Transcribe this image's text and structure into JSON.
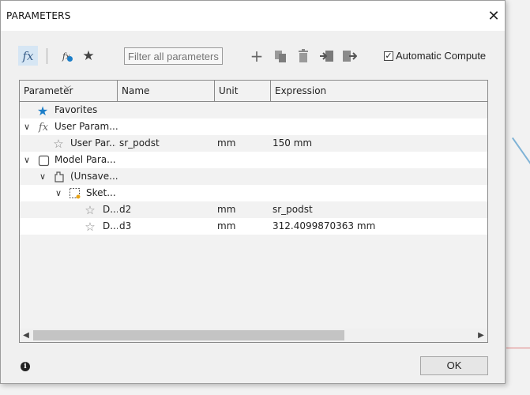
{
  "dialog": {
    "title": "PARAMETERS"
  },
  "toolbar": {
    "fx_label": "fx",
    "fx_user_label": "fx",
    "filter_placeholder": "Filter all parameters",
    "auto_compute_label": "Automatic Compute",
    "auto_compute_checked": "✓",
    "plus": "+"
  },
  "table": {
    "columns": [
      "Parameter",
      "Name",
      "Unit",
      "Expression"
    ],
    "rows": [
      {
        "param": "Favorites",
        "name": "",
        "unit": "",
        "expr": ""
      },
      {
        "param": "User Param...",
        "name": "",
        "unit": "",
        "expr": ""
      },
      {
        "param": "User Par...",
        "name": "sr_podst",
        "unit": "mm",
        "expr": "150 mm"
      },
      {
        "param": "Model Para...",
        "name": "",
        "unit": "",
        "expr": ""
      },
      {
        "param": "(Unsave...",
        "name": "",
        "unit": "",
        "expr": ""
      },
      {
        "param": "Sket...",
        "name": "",
        "unit": "",
        "expr": ""
      },
      {
        "param": "D...",
        "name": "d2",
        "unit": "mm",
        "expr": "sr_podst"
      },
      {
        "param": "D...",
        "name": "d3",
        "unit": "mm",
        "expr": "312.4099870363 mm"
      }
    ]
  },
  "footer": {
    "ok_label": "OK",
    "info_glyph": "i"
  },
  "colors": {
    "accent": "#1c7ec8",
    "selected_tool_bg": "#d6e6f4"
  },
  "icons": [
    "fx-icon",
    "user-fx-icon",
    "star-icon",
    "add-icon",
    "copy-icon",
    "delete-icon",
    "import-icon",
    "export-icon",
    "info-icon",
    "close-icon",
    "chevron-down-icon",
    "sketch-icon",
    "component-icon",
    "body-icon"
  ]
}
